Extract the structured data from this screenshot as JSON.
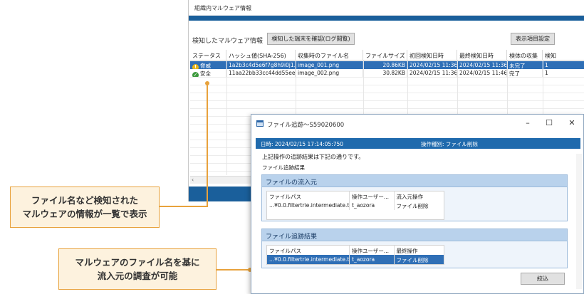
{
  "back_window": {
    "title": "組織内マルウェア情報",
    "toolbar": {
      "section_title": "検知したマルウェア情報",
      "check_terminals_button": "検知した端末を確認(ログ閲覧)",
      "display_settings_button": "表示項目設定"
    },
    "columns": [
      "ステータス",
      "ハッシュ値(SHA-256)",
      "収集時のファイル名",
      "ファイルサイズ",
      "初回検知日時",
      "最終検知日時",
      "検体の収集",
      "検知"
    ],
    "rows": [
      {
        "status": "脅威",
        "status_icon": "warning-icon",
        "hash": "1a2b3c4d5e6f7g8h9i0j1...",
        "filename": "image_001.png",
        "size": "20.86KB",
        "first_detected": "2024/02/15 11:36",
        "last_detected": "2024/02/15 11:36",
        "collection": "未完了",
        "count": "1"
      },
      {
        "status": "安全",
        "status_icon": "check-icon",
        "hash": "11aa22bb33cc44dd55ee...",
        "filename": "image_002.png",
        "size": "30.82KB",
        "first_detected": "2024/02/15 11:36",
        "last_detected": "2024/02/15 11:46",
        "collection": "完了",
        "count": "1"
      }
    ]
  },
  "callouts": {
    "top": [
      "ファイル名など検知された",
      "マルウェアの情報が一覧で表示"
    ],
    "bottom": [
      "マルウェアのファイル名を基に",
      "流入元の調査が可能"
    ]
  },
  "dialog": {
    "title": "ファイル追跡～S59020600",
    "info_datetime": "日時: 2024/02/15  17:14:05:750",
    "info_operation": "操作種別: ファイル削除",
    "message": "上記操作の追跡結果は下記の通りです。",
    "subheading": "ファイル追跡結果",
    "source_group": {
      "title": "ファイルの流入元",
      "columns": [
        "ファイルパス",
        "操作ユーザー...",
        "流入元操作"
      ],
      "rows": [
        [
          "...¥0.0.filtertrie.intermediate.txt",
          "t_aozora",
          "ファイル削除"
        ]
      ]
    },
    "tracking_group": {
      "title": "ファイル追跡結果",
      "columns": [
        "ファイルパス",
        "操作ユーザー...",
        "最終操作"
      ],
      "rows": [
        [
          "...¥0.0.filtertrie.intermediate.txt",
          "t_aozora",
          "ファイル削除"
        ]
      ]
    },
    "filter_button": "絞込"
  },
  "colors": {
    "accent": "#1a5f9b",
    "selection": "#2f6fb6",
    "callout_border": "#e8a23c",
    "callout_fill": "#fdf2de"
  }
}
